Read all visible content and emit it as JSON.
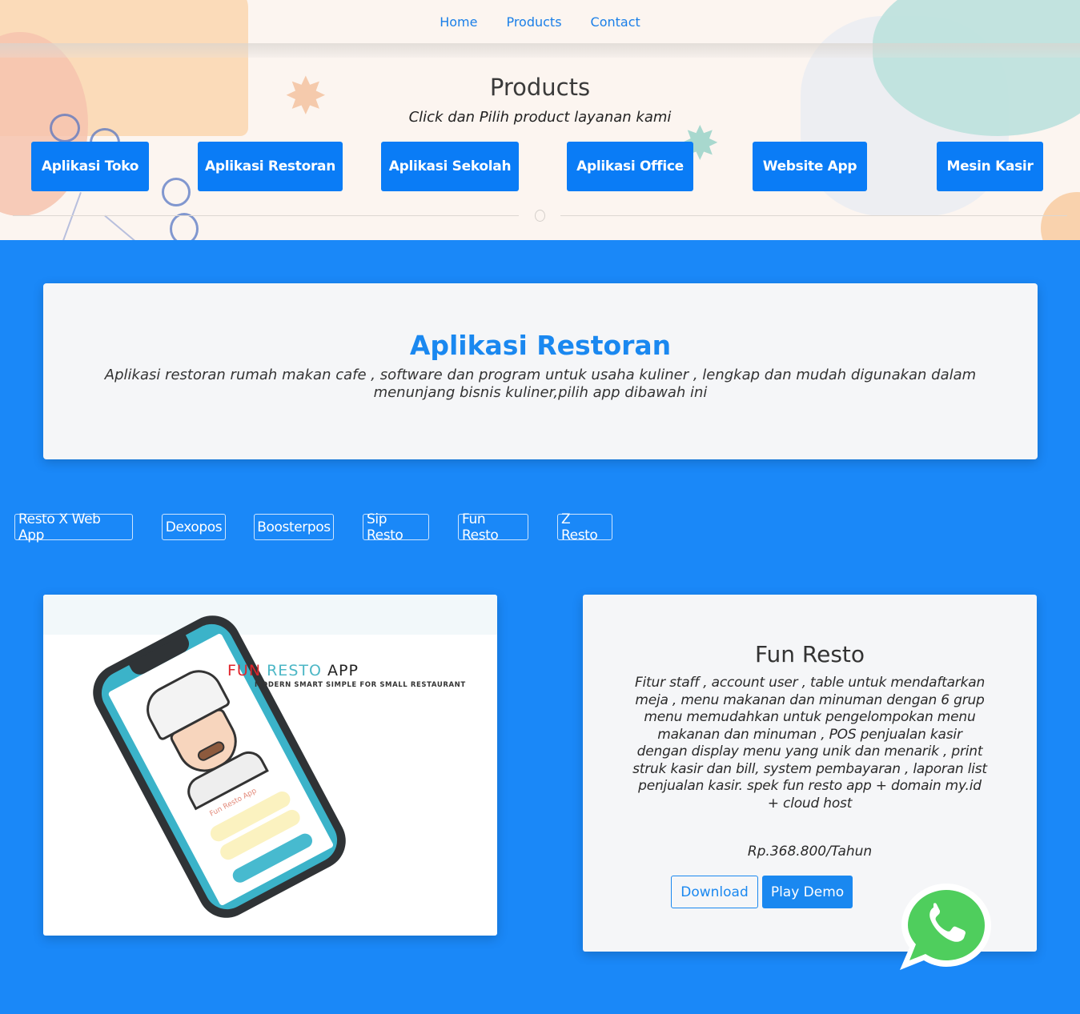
{
  "nav": {
    "items": [
      {
        "label": "Home"
      },
      {
        "label": "Products"
      },
      {
        "label": "Contact"
      }
    ]
  },
  "products_section": {
    "title": "Products",
    "subtitle": "Click dan Pilih product layanan kami",
    "categories": [
      {
        "label": "Aplikasi Toko"
      },
      {
        "label": "Aplikasi Restoran"
      },
      {
        "label": "Aplikasi Sekolah"
      },
      {
        "label": "Aplikasi Office"
      },
      {
        "label": "Website App"
      },
      {
        "label": "Mesin Kasir"
      }
    ]
  },
  "category_intro": {
    "title": "Aplikasi Restoran",
    "description": "Aplikasi restoran rumah makan cafe , software dan program untuk usaha kuliner , lengkap dan mudah digunakan dalam menunjang bisnis kuliner,pilih app dibawah ini"
  },
  "sub_products": [
    {
      "label": "Resto X Web App"
    },
    {
      "label": "Dexopos"
    },
    {
      "label": "Boosterpos"
    },
    {
      "label": "Sip Resto"
    },
    {
      "label": "Fun Resto"
    },
    {
      "label": "Z Resto"
    }
  ],
  "product_image": {
    "brand_fun": "FUN",
    "brand_resto": "RESTO",
    "brand_app": "APP",
    "tagline": "MODERN SMART SIMPLE FOR SMALL RESTAURANT",
    "mini_title": "Fun Resto App"
  },
  "product_detail": {
    "title": "Fun Resto",
    "description": "Fitur staff , account user , table untuk mendaftarkan meja , menu makanan dan minuman dengan 6 grup menu memudahkan untuk pengelompokan menu makanan dan minuman , POS penjualan kasir dengan display menu yang unik dan menarik , print struk kasir dan bill, system pembayaran , laporan list penjualan kasir. spek fun resto app + domain my.id + cloud host",
    "price": "Rp.368.800/Tahun",
    "download_label": "Download",
    "demo_label": "Play Demo"
  },
  "colors": {
    "primary": "#0a7cf6",
    "section_bg": "#1a88f8",
    "whatsapp": "#4fce5d"
  },
  "floating": {
    "icon": "whatsapp-icon"
  }
}
